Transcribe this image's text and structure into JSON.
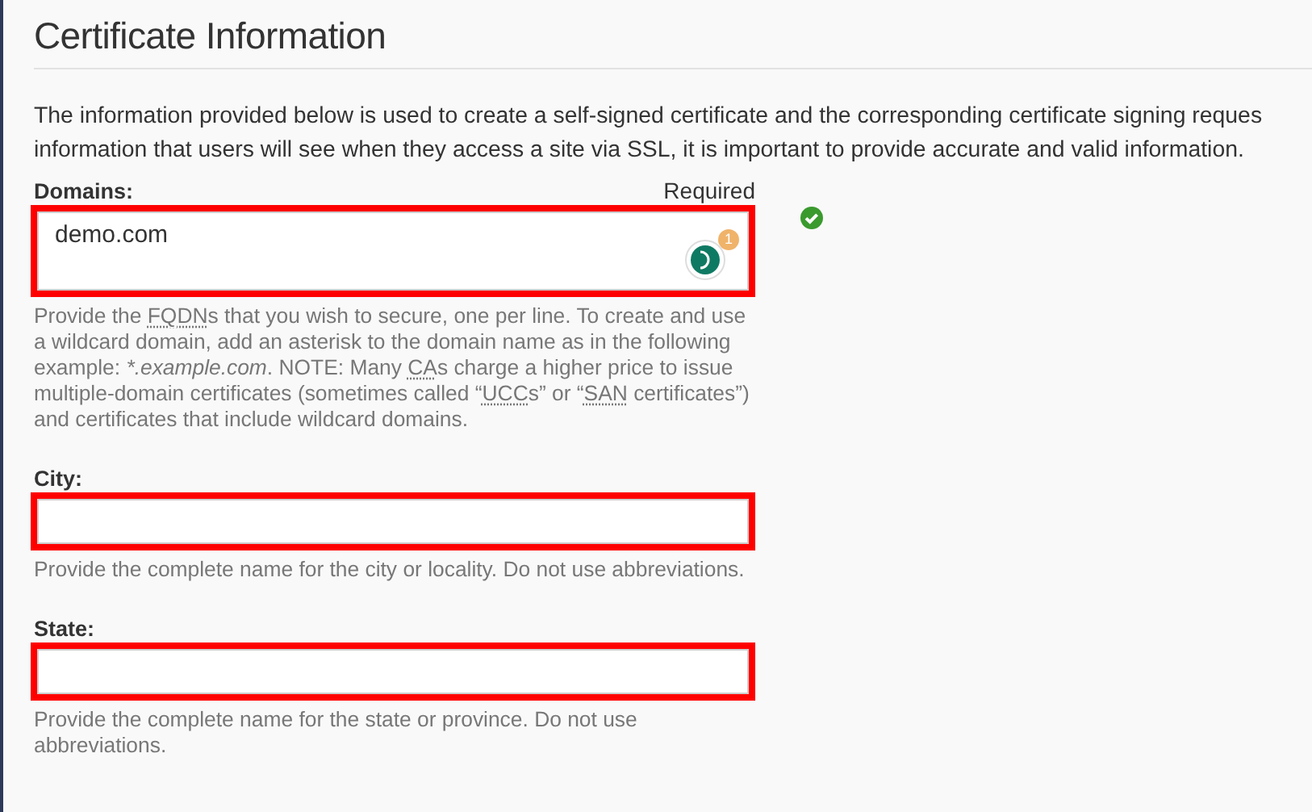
{
  "title": "Certificate Information",
  "description_lines": [
    "The information provided below is used to create a self-signed certificate and the corresponding certificate signing reques",
    "information that users will see when they access a site via SSL, it is important to provide accurate and valid information."
  ],
  "fields": [
    {
      "label": "Domains:",
      "required_text": "Required",
      "kind": "textarea",
      "value": "demo.com",
      "highlighted": true,
      "valid": true,
      "assistant_badge": "1",
      "help": [
        {
          "kind": "text",
          "text": "Provide the "
        },
        {
          "kind": "abbr",
          "text": "FQDN"
        },
        {
          "kind": "text",
          "text": "s that you wish to secure, one per line. To create and use a wildcard domain, add an asterisk to the domain name as in the following example: "
        },
        {
          "kind": "em",
          "text": "*.example.com"
        },
        {
          "kind": "text",
          "text": ". NOTE: Many "
        },
        {
          "kind": "abbr",
          "text": "CA"
        },
        {
          "kind": "text",
          "text": "s charge a higher price to issue multiple-domain certificates (sometimes called “"
        },
        {
          "kind": "abbr",
          "text": "UCC"
        },
        {
          "kind": "text",
          "text": "s” or “"
        },
        {
          "kind": "abbr",
          "text": "SAN"
        },
        {
          "kind": "text",
          "text": " certificates”) and certificates that include wildcard domains."
        }
      ]
    },
    {
      "label": "City:",
      "kind": "input",
      "highlighted": true,
      "valid": false,
      "help": [
        {
          "kind": "text",
          "text": "Provide the complete name for the city or locality. Do not use abbreviations."
        }
      ]
    },
    {
      "label": "State:",
      "kind": "input",
      "highlighted": true,
      "valid": false,
      "help": [
        {
          "kind": "text",
          "text": "Provide the complete name for the state or province. Do not use abbreviations."
        }
      ]
    }
  ]
}
